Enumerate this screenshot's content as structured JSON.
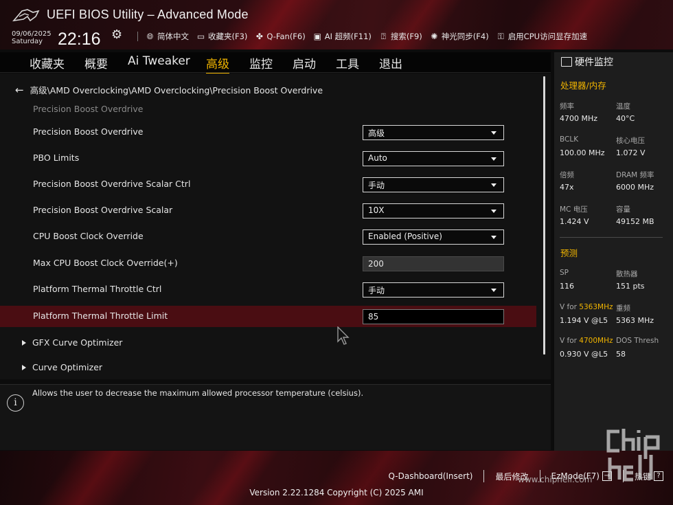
{
  "header": {
    "title": "UEFI BIOS Utility – Advanced Mode",
    "date": "09/06/2025",
    "weekday": "Saturday",
    "time": "22:16",
    "toolbar": [
      {
        "name": "language",
        "icon": "globe-icon",
        "label": "简体中文"
      },
      {
        "name": "favorites",
        "icon": "folder-star-icon",
        "label": "收藏夹(F3)"
      },
      {
        "name": "qfan",
        "icon": "fan-icon",
        "label": "Q-Fan(F6)"
      },
      {
        "name": "ai-oc",
        "icon": "ai-chip-icon",
        "label": "AI 超频(F11)"
      },
      {
        "name": "search",
        "icon": "search-help-icon",
        "label": "搜索(F9)"
      },
      {
        "name": "aura",
        "icon": "aura-light-icon",
        "label": "神光同步(F4)"
      },
      {
        "name": "resizable-bar",
        "icon": "cpu-gpu-icon",
        "label": "启用CPU访问显存加速"
      }
    ]
  },
  "menu": {
    "tabs": [
      {
        "label": "收藏夹",
        "active": false
      },
      {
        "label": "概要",
        "active": false
      },
      {
        "label": "Ai Tweaker",
        "active": false
      },
      {
        "label": "高级",
        "active": true
      },
      {
        "label": "监控",
        "active": false
      },
      {
        "label": "启动",
        "active": false
      },
      {
        "label": "工具",
        "active": false
      },
      {
        "label": "退出",
        "active": false
      }
    ]
  },
  "content": {
    "breadcrumb": "高级\\AMD Overclocking\\AMD Overclocking\\Precision Boost Overdrive",
    "section_header": "Precision Boost Overdrive",
    "rows": [
      {
        "label": "Precision Boost Overdrive",
        "type": "dropdown",
        "value": "高级"
      },
      {
        "label": "PBO Limits",
        "type": "dropdown",
        "value": "Auto"
      },
      {
        "label": "Precision Boost Overdrive Scalar Ctrl",
        "type": "dropdown",
        "value": "手动"
      },
      {
        "label": "Precision Boost Overdrive Scalar",
        "type": "dropdown",
        "value": "10X"
      },
      {
        "label": "CPU Boost Clock Override",
        "type": "dropdown",
        "value": "Enabled (Positive)"
      },
      {
        "label": "Max CPU Boost Clock Override(+)",
        "type": "text",
        "value": "200"
      },
      {
        "label": "Platform Thermal Throttle Ctrl",
        "type": "dropdown",
        "value": "手动"
      },
      {
        "label": "Platform Thermal Throttle Limit",
        "type": "text-editing",
        "value": "85",
        "selected": true
      }
    ],
    "submenus": [
      {
        "label": "GFX Curve Optimizer"
      },
      {
        "label": "Curve Optimizer"
      }
    ]
  },
  "help": {
    "text": "Allows the user to decrease the maximum allowed processor temperature (celsius)."
  },
  "monitor": {
    "title": "硬件监控",
    "cpu_section": "处理器/内存",
    "cpu_items": [
      {
        "label": "频率",
        "value": "4700 MHz"
      },
      {
        "label": "温度",
        "value": "40°C"
      },
      {
        "label": "BCLK",
        "value": "100.00 MHz"
      },
      {
        "label": "核心电压",
        "value": "1.072 V"
      },
      {
        "label": "倍频",
        "value": "47x"
      },
      {
        "label": "DRAM 频率",
        "value": "6000 MHz"
      },
      {
        "label": "MC 电压",
        "value": "1.424 V"
      },
      {
        "label": "容量",
        "value": "49152 MB"
      }
    ],
    "predict_section": "预测",
    "predict_items": [
      {
        "label": "SP",
        "value": "116"
      },
      {
        "label": "散热器",
        "value": "151 pts"
      },
      {
        "label_prefix": "V for ",
        "label_highlight": "5363MHz",
        "value": "1.194 V @L5"
      },
      {
        "label": "重频",
        "value": "5363 MHz"
      },
      {
        "label_prefix": "V for ",
        "label_highlight": "4700MHz",
        "value": "0.930 V @L5"
      },
      {
        "label": "DOS Thresh",
        "value": "58"
      }
    ]
  },
  "footer": {
    "qdashboard": "Q-Dashboard(Insert)",
    "last_modified": "最后修改",
    "ezmode": "EzMode(F7)",
    "hotkeys": "热键",
    "version": "Version 2.22.1284 Copyright (C) 2025 AMI"
  },
  "watermark": {
    "url": "www.chiphell.com"
  },
  "colors": {
    "accent": "#f0b400",
    "selected_row": "#4a0d12",
    "brand_red": "#c8141e"
  }
}
